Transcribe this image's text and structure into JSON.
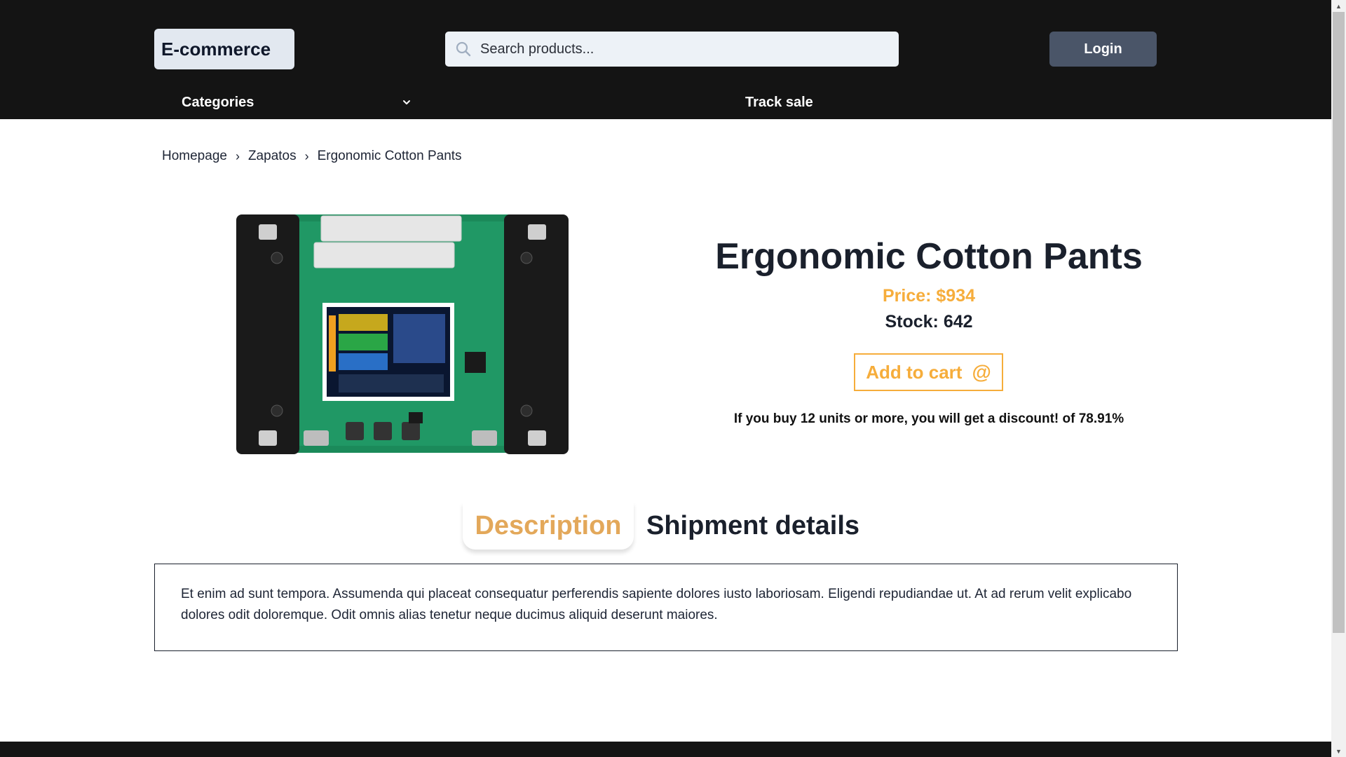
{
  "header": {
    "logo": "E-commerce",
    "search_placeholder": "Search products...",
    "login_label": "Login",
    "nav": {
      "categories_label": "Categories",
      "track_label": "Track sale"
    }
  },
  "breadcrumb": {
    "items": [
      "Homepage",
      "Zapatos",
      "Ergonomic Cotton Pants"
    ],
    "separator": "›"
  },
  "product": {
    "image_alt": "product-image",
    "title": "Ergonomic Cotton Pants",
    "price": "Price: $934",
    "stock": "Stock: 642",
    "add_to_cart_label": "Add to cart",
    "add_to_cart_icon": "@",
    "discount_text": "If you buy 12 units or more, you will get a discount! of 78.91%"
  },
  "tabs": {
    "description_label": "Description",
    "shipment_label": "Shipment details",
    "active": "Description"
  },
  "description": {
    "text": "Et enim ad sunt tempora. Assumenda qui placeat consequatur perferendis sapiente dolores iusto laboriosam. Eligendi repudiandae ut. At ad rerum velit explicabo dolores odit doloremque. Odit omnis alias tenetur neque ducimus aliquid deserunt maiores."
  },
  "colors": {
    "header_bg": "#141414",
    "accent": "#f6ad3b",
    "login_bg": "#4a5568",
    "logo_bg": "#e2e8f0",
    "search_bg": "#edf2f7"
  }
}
